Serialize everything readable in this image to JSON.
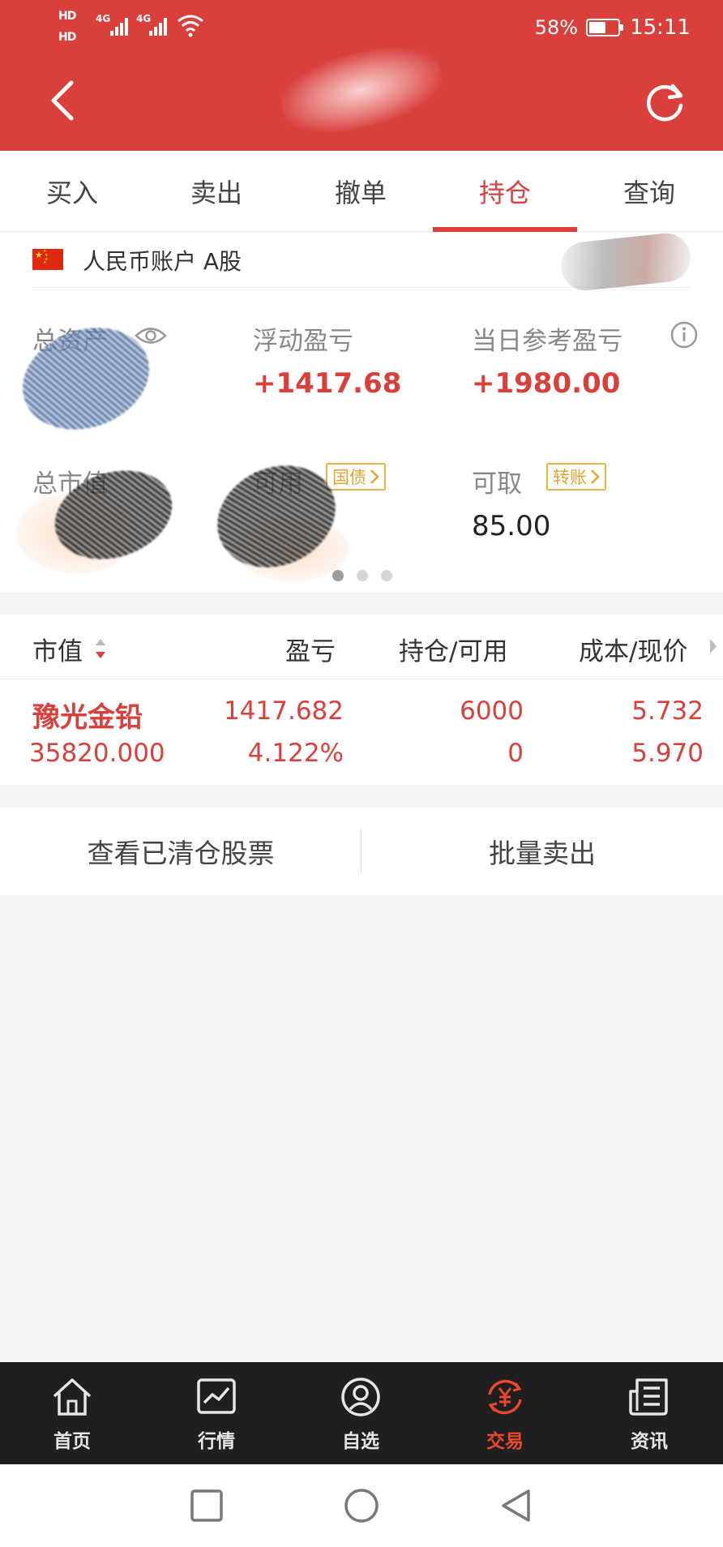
{
  "status_bar": {
    "hd1": "HD",
    "hd2": "HD",
    "net1": "4G",
    "net2": "4G",
    "battery_pct": "58%",
    "battery_level": 0.58,
    "time": "15:11"
  },
  "header": {
    "back_icon": "chevron-left-icon",
    "refresh_icon": "refresh-icon"
  },
  "tabs": [
    {
      "label": "买入"
    },
    {
      "label": "卖出"
    },
    {
      "label": "撤单"
    },
    {
      "label": "持仓"
    },
    {
      "label": "查询"
    }
  ],
  "active_tab": "持仓",
  "account": {
    "label": "人民币账户 A股"
  },
  "metrics": {
    "total_assets_label": "总资产",
    "floating_pl_label": "浮动盈亏",
    "floating_pl_value": "+1417.68",
    "daily_pl_label": "当日参考盈亏",
    "daily_pl_value": "+1980.00",
    "market_value_label": "总市值",
    "available_label": "可用",
    "bond_tag": "国债",
    "withdrawable_label": "可取",
    "withdrawable_value": "85.00",
    "transfer_tag": "转账"
  },
  "holdings": {
    "columns": [
      "市值",
      "盈亏",
      "持仓/可用",
      "成本/现价"
    ],
    "rows": [
      {
        "name": "豫光金铅",
        "market_value": "35820.000",
        "pl": "1417.682",
        "pl_pct": "4.122%",
        "position": "6000",
        "available": "0",
        "cost": "5.732",
        "price": "5.970"
      }
    ]
  },
  "actions": {
    "cleared_label": "查看已清仓股票",
    "batch_sell_label": "批量卖出"
  },
  "bottom_nav": [
    {
      "label": "首页",
      "icon": "home-icon"
    },
    {
      "label": "行情",
      "icon": "chart-icon"
    },
    {
      "label": "自选",
      "icon": "user-circle-icon"
    },
    {
      "label": "交易",
      "icon": "yuan-exchange-icon"
    },
    {
      "label": "资讯",
      "icon": "news-icon"
    }
  ],
  "active_nav": "交易",
  "colors": {
    "brand_red": "#d9403c",
    "tag_gold": "#e0a42f",
    "nav_active": "#e8482f"
  }
}
